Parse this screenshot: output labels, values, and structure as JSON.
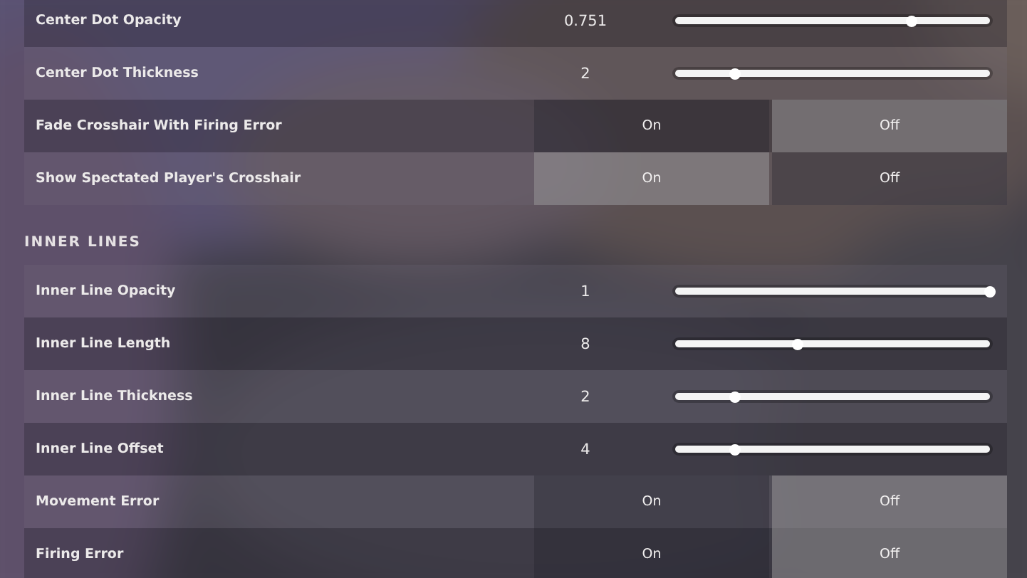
{
  "sections": [
    {
      "items": [
        {
          "kind": "slider",
          "label": "Center Dot Opacity",
          "reading": "0.751",
          "level": 0.75
        },
        {
          "kind": "slider",
          "label": "Center Dot Thickness",
          "reading": "2",
          "level": 0.19
        },
        {
          "kind": "toggle",
          "label": "Fade Crosshair With Firing Error",
          "options": [
            {
              "label": "On",
              "selected": false
            },
            {
              "label": "Off",
              "selected": true
            }
          ]
        },
        {
          "kind": "toggle",
          "label": "Show Spectated Player's Crosshair",
          "options": [
            {
              "label": "On",
              "selected": true
            },
            {
              "label": "Off",
              "selected": false
            }
          ]
        }
      ]
    },
    {
      "title": "INNER LINES",
      "items": [
        {
          "kind": "slider",
          "label": "Inner Line Opacity",
          "reading": "1",
          "level": 1
        },
        {
          "kind": "slider",
          "label": "Inner Line Length",
          "reading": "8",
          "level": 0.39
        },
        {
          "kind": "slider",
          "label": "Inner Line Thickness",
          "reading": "2",
          "level": 0.19
        },
        {
          "kind": "slider",
          "label": "Inner Line Offset",
          "reading": "4",
          "level": 0.19
        },
        {
          "kind": "toggle",
          "label": "Movement Error",
          "options": [
            {
              "label": "On",
              "selected": false
            },
            {
              "label": "Off",
              "selected": true
            }
          ]
        },
        {
          "kind": "toggle",
          "label": "Firing Error",
          "options": [
            {
              "label": "On",
              "selected": false
            },
            {
              "label": "Off",
              "selected": true
            }
          ]
        }
      ]
    }
  ]
}
